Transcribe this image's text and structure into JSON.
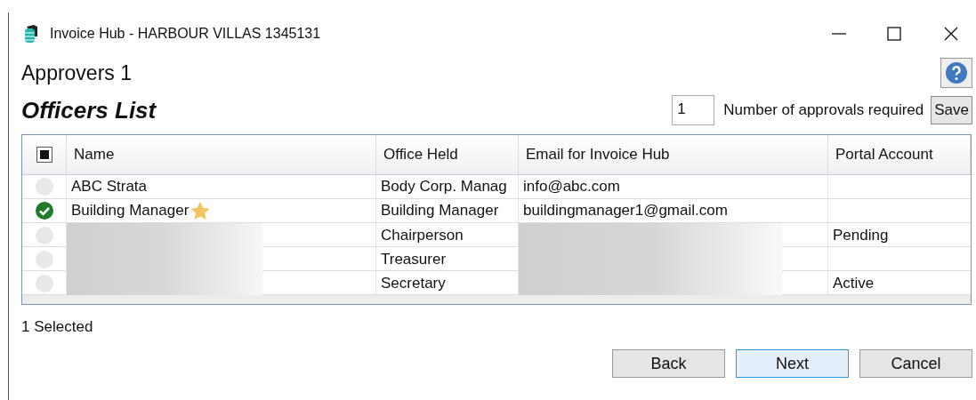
{
  "window": {
    "title": "Invoice Hub - HARBOUR VILLAS 1345131"
  },
  "heading": "Approvers 1",
  "section_title": "Officers List",
  "approvals": {
    "value": "1",
    "label": "Number of approvals required",
    "save": "Save"
  },
  "table": {
    "select_all": {
      "checked": true
    },
    "columns": [
      "Name",
      "Office Held",
      "Email for Invoice Hub",
      "Portal Account"
    ],
    "rows": [
      {
        "checked": false,
        "name": "ABC Strata",
        "starred": false,
        "office": "Body Corp. Manag",
        "email": "info@abc.com",
        "portal": "",
        "blurred": false
      },
      {
        "checked": true,
        "name": "Building Manager",
        "starred": true,
        "office": "Building Manager",
        "email": "buildingmanager1@gmail.com",
        "portal": "",
        "blurred": false
      },
      {
        "checked": false,
        "name": "",
        "starred": false,
        "office": "Chairperson",
        "email": "",
        "portal": "Pending",
        "blurred": true
      },
      {
        "checked": false,
        "name": "",
        "starred": false,
        "office": "Treasurer",
        "email": "",
        "portal": "",
        "blurred": true
      },
      {
        "checked": false,
        "name": "",
        "starred": false,
        "office": "Secretary",
        "email": "",
        "portal": "Active",
        "blurred": true
      }
    ]
  },
  "status": "1 Selected",
  "buttons": [
    {
      "label": "Back",
      "default": false
    },
    {
      "label": "Next",
      "default": true
    },
    {
      "label": "Cancel",
      "default": false
    }
  ]
}
